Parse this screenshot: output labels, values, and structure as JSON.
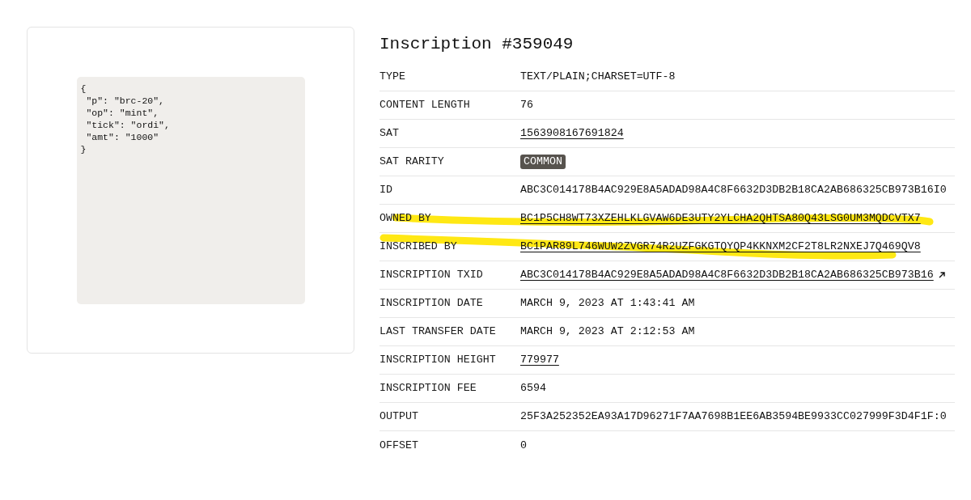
{
  "preview": {
    "content": "{\n \"p\": \"brc-20\",\n \"op\": \"mint\",\n \"tick\": \"ordi\",\n \"amt\": \"1000\"\n}"
  },
  "title": "Inscription #359049",
  "details": [
    {
      "label": "TYPE",
      "value": "TEXT/PLAIN;CHARSET=UTF-8",
      "kind": "text",
      "highlighted": false
    },
    {
      "label": "CONTENT LENGTH",
      "value": "76",
      "kind": "text",
      "highlighted": false
    },
    {
      "label": "SAT",
      "value": "1563908167691824",
      "kind": "link",
      "highlighted": false
    },
    {
      "label": "SAT RARITY",
      "value": "COMMON",
      "kind": "badge",
      "highlighted": false
    },
    {
      "label": "ID",
      "value": "ABC3C014178B4AC929E8A5ADAD98A4C8F6632D3DB2B18CA2AB686325CB973B16I0",
      "kind": "text",
      "highlighted": false
    },
    {
      "label": "OWNED BY",
      "value": "BC1P5CH8WT73XZEHLKLGVAW6DE3UTY2YLCHA2QHTSA80Q43LSG0UM3MQDCVTX7",
      "kind": "link",
      "highlighted": true
    },
    {
      "label": "INSCRIBED BY",
      "value": "BC1PAR89L746WUW2ZVGR74R2UZFGKGTQYQP4KKNXM2CF2T8LR2NXEJ7Q469QV8",
      "kind": "link",
      "highlighted": true
    },
    {
      "label": "INSCRIPTION TXID",
      "value": "ABC3C014178B4AC929E8A5ADAD98A4C8F6632D3DB2B18CA2AB686325CB973B16",
      "kind": "external_link",
      "highlighted": false
    },
    {
      "label": "INSCRIPTION DATE",
      "value": "MARCH 9, 2023 AT 1:43:41 AM",
      "kind": "text",
      "highlighted": false
    },
    {
      "label": "LAST TRANSFER DATE",
      "value": "MARCH 9, 2023 AT 2:12:53 AM",
      "kind": "text",
      "highlighted": false
    },
    {
      "label": "INSCRIPTION HEIGHT",
      "value": "779977",
      "kind": "link",
      "highlighted": false
    },
    {
      "label": "INSCRIPTION FEE",
      "value": "6594",
      "kind": "text",
      "highlighted": false
    },
    {
      "label": "OUTPUT",
      "value": "25F3A252352EA93A17D96271F7AA7698B1EE6AB3594BE9933CC027999F3D4F1F:0",
      "kind": "text",
      "highlighted": false
    },
    {
      "label": "OFFSET",
      "value": "0",
      "kind": "text",
      "highlighted": false
    }
  ]
}
